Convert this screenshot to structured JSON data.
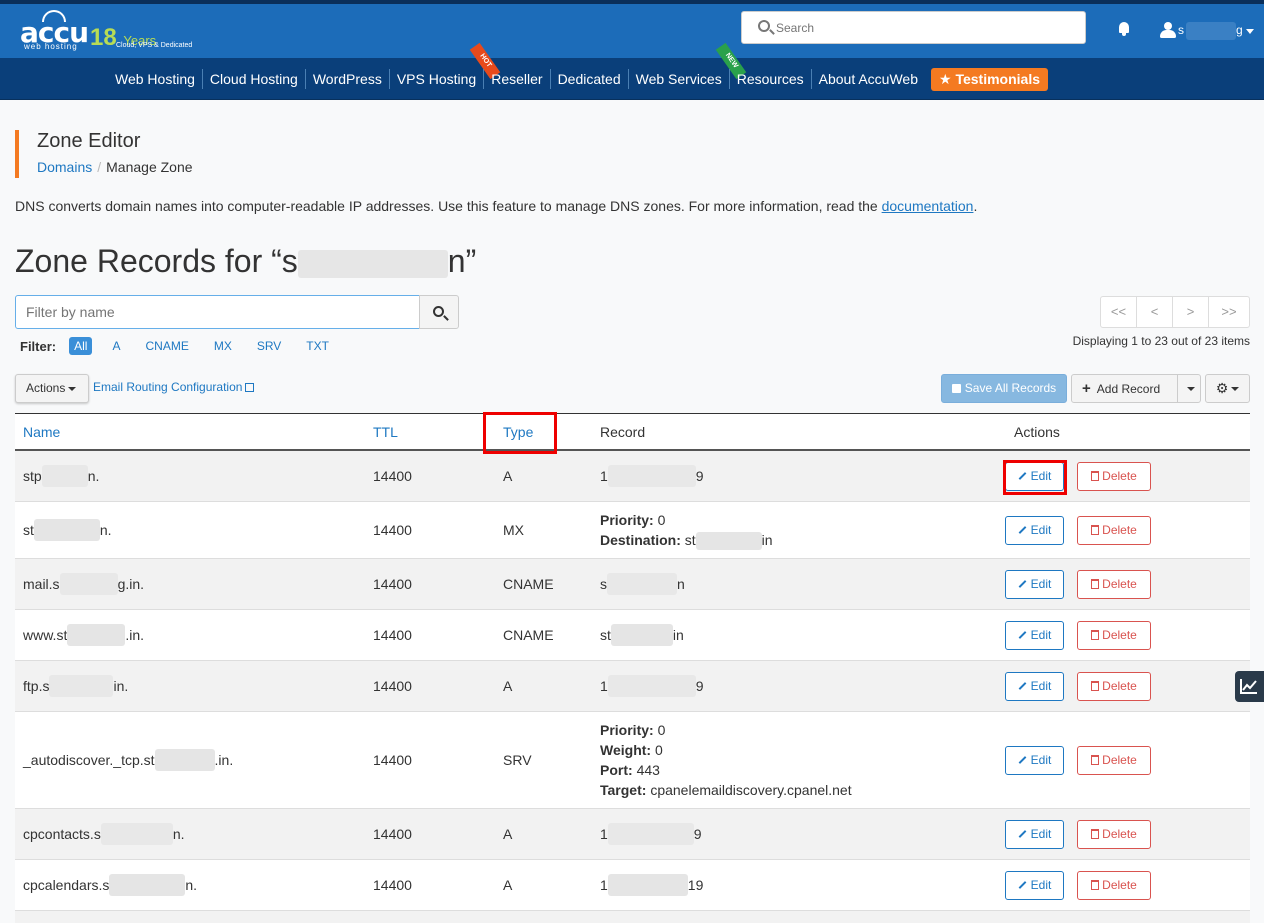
{
  "header": {
    "logo_text": "accu",
    "logo_sub": "web hosting",
    "logo_years": "18",
    "logo_years_word": "Years",
    "logo_tagline": "Cloud, VPS & Dedicated",
    "search_placeholder": "Search",
    "user_initial": "s",
    "user_end": "g"
  },
  "nav": {
    "items": [
      "Web Hosting",
      "Cloud Hosting",
      "WordPress",
      "VPS Hosting",
      "Reseller",
      "Dedicated",
      "Web Services",
      "Resources",
      "About AccuWeb"
    ],
    "hot_label": "HOT",
    "new_label": "NEW",
    "testimonials": "Testimonials",
    "testimonials_star": "★"
  },
  "page": {
    "title": "Zone Editor",
    "breadcrumb_root": "Domains",
    "breadcrumb_sep": "/",
    "breadcrumb_current": "Manage Zone",
    "intro_text": "DNS converts domain names into computer-readable IP addresses. Use this feature to manage DNS zones. For more information, read the ",
    "intro_link": "documentation",
    "intro_end": ".",
    "zone_title_start": "Zone Records for “s",
    "zone_title_end": "n”"
  },
  "filter": {
    "placeholder": "Filter by name",
    "label": "Filter:",
    "chips": [
      "All",
      "A",
      "CNAME",
      "MX",
      "SRV",
      "TXT"
    ],
    "active": "All"
  },
  "pager": {
    "buttons": [
      "<<",
      "<",
      ">",
      ">>"
    ],
    "displaying": "Displaying 1 to 23 out of 23 items"
  },
  "toolbar": {
    "actions": "Actions",
    "email_routing": "Email Routing Configuration",
    "save_all": "Save All Records",
    "add_record": "Add Record",
    "gear": "⚙"
  },
  "table": {
    "headers": {
      "name": "Name",
      "ttl": "TTL",
      "type": "Type",
      "record": "Record",
      "actions": "Actions"
    },
    "edit_label": "Edit",
    "delete_label": "Delete",
    "rows": [
      {
        "name_a": "stp",
        "name_b": "n.",
        "ttl": "14400",
        "type": "A",
        "rec_a": "1",
        "rec_b": "9"
      },
      {
        "name_a": "st",
        "name_b": "n.",
        "ttl": "14400",
        "type": "MX",
        "priority_label": "Priority:",
        "priority": "0",
        "dest_label": "Destination:",
        "dest_a": "st",
        "dest_b": "in"
      },
      {
        "name_a": "mail.s",
        "name_b": "g.in.",
        "ttl": "14400",
        "type": "CNAME",
        "rec_a": "s",
        "rec_b": "n"
      },
      {
        "name_a": "www.st",
        "name_b": ".in.",
        "ttl": "14400",
        "type": "CNAME",
        "rec_a": "st",
        "rec_b": "in"
      },
      {
        "name_a": "ftp.s",
        "name_b": "in.",
        "ttl": "14400",
        "type": "A",
        "rec_a": "1",
        "rec_b": "9"
      },
      {
        "name_a": "_autodiscover._tcp.st",
        "name_b": ".in.",
        "ttl": "14400",
        "type": "SRV",
        "priority_label": "Priority:",
        "priority": "0",
        "weight_label": "Weight:",
        "weight": "0",
        "port_label": "Port:",
        "port": "443",
        "target_label": "Target:",
        "target": "cpanelemaildiscovery.cpanel.net"
      },
      {
        "name_a": "cpcontacts.s",
        "name_b": "n.",
        "ttl": "14400",
        "type": "A",
        "rec_a": "1",
        "rec_b": "9"
      },
      {
        "name_a": "cpcalendars.s",
        "name_b": "n.",
        "ttl": "14400",
        "type": "A",
        "rec_a": "1",
        "rec_b": "19"
      }
    ]
  },
  "colors": {
    "topbar": "#1c6cb9",
    "nav": "#0a3f7a",
    "accent": "#f47a21",
    "link": "#1e78c2",
    "danger": "#d9534f",
    "highlight": "#e00000"
  }
}
